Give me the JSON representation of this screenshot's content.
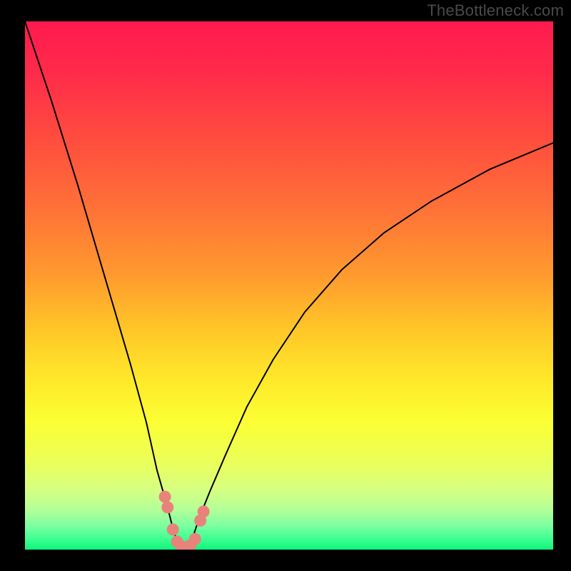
{
  "watermark": "TheBottleneck.com",
  "chart_data": {
    "type": "line",
    "title": "",
    "xlabel": "",
    "ylabel": "",
    "xlim": [
      0,
      100
    ],
    "ylim": [
      0,
      100
    ],
    "series": [
      {
        "name": "bottleneck-curve",
        "x": [
          0,
          5,
          10,
          15,
          20,
          23,
          25,
          27,
          28,
          29,
          29.5,
          30,
          30.5,
          31,
          32,
          33,
          35,
          38,
          42,
          47,
          53,
          60,
          68,
          77,
          88,
          100
        ],
        "values": [
          100,
          85,
          69,
          52,
          35,
          24,
          15,
          8,
          4,
          1,
          0.5,
          0,
          0.5,
          1,
          3,
          6,
          11,
          18,
          27,
          36,
          45,
          53,
          60,
          66,
          72,
          77
        ]
      }
    ],
    "bottleneck_min_x": 30,
    "markers": {
      "name": "highlight-dots",
      "color": "#e8837b",
      "points": [
        {
          "x": 26.5,
          "y": 10.0
        },
        {
          "x": 27.0,
          "y": 8.0
        },
        {
          "x": 28.0,
          "y": 3.8
        },
        {
          "x": 28.8,
          "y": 1.5
        },
        {
          "x": 29.6,
          "y": 0.6
        },
        {
          "x": 30.5,
          "y": 0.4
        },
        {
          "x": 31.3,
          "y": 0.8
        },
        {
          "x": 32.2,
          "y": 2.0
        },
        {
          "x": 33.2,
          "y": 5.5
        },
        {
          "x": 33.8,
          "y": 7.2
        }
      ]
    },
    "gradient_stops": [
      {
        "offset": 0.0,
        "color": "#ff1a4f"
      },
      {
        "offset": 0.1,
        "color": "#ff2b4a"
      },
      {
        "offset": 0.22,
        "color": "#ff4c3e"
      },
      {
        "offset": 0.35,
        "color": "#ff7038"
      },
      {
        "offset": 0.48,
        "color": "#ff9a2e"
      },
      {
        "offset": 0.58,
        "color": "#ffc528"
      },
      {
        "offset": 0.68,
        "color": "#ffe92a"
      },
      {
        "offset": 0.76,
        "color": "#fbff34"
      },
      {
        "offset": 0.83,
        "color": "#ecff57"
      },
      {
        "offset": 0.885,
        "color": "#d7ff80"
      },
      {
        "offset": 0.925,
        "color": "#b3ff99"
      },
      {
        "offset": 0.955,
        "color": "#7cffa0"
      },
      {
        "offset": 0.978,
        "color": "#42ff95"
      },
      {
        "offset": 1.0,
        "color": "#10f57a"
      }
    ]
  }
}
